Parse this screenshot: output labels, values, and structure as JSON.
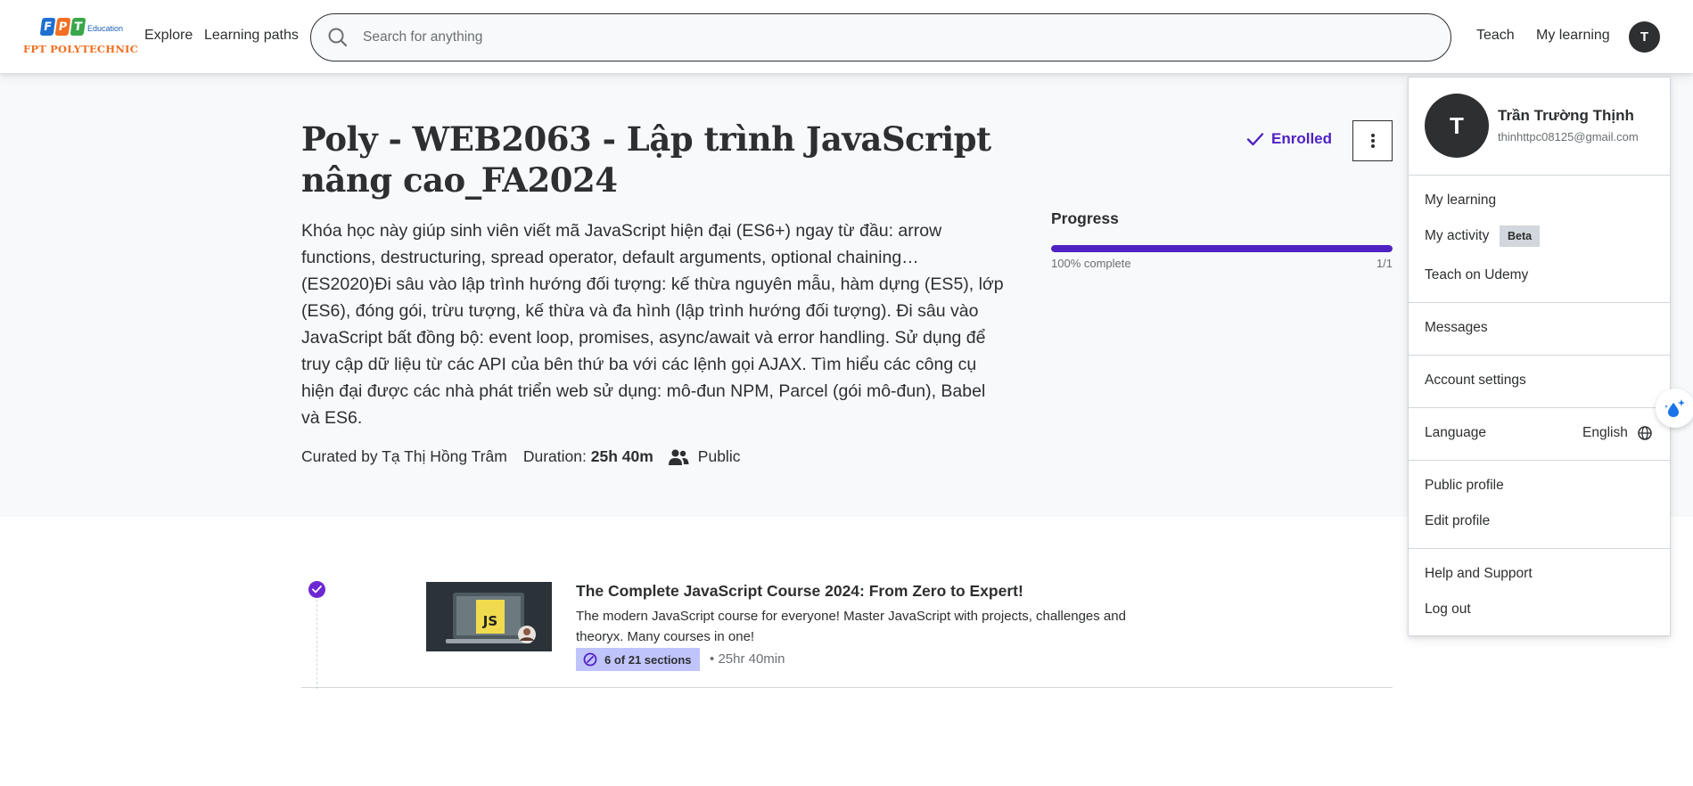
{
  "header": {
    "logo": {
      "letters": [
        "F",
        "P",
        "T"
      ],
      "colors": [
        "#1f6fd1",
        "#f26f21",
        "#3aa64a"
      ],
      "education": "Education",
      "wordmark": "FPT POLYTECHNIC"
    },
    "nav": {
      "explore": "Explore",
      "learning_paths": "Learning paths"
    },
    "search": {
      "placeholder": "Search for anything",
      "icon": "search-icon"
    },
    "right": {
      "teach": "Teach",
      "my_learning": "My learning",
      "avatar_initial": "T"
    }
  },
  "course_path": {
    "title": "Poly - WEB2063 - Lập trình JavaScript nâng cao_FA2024",
    "description": "Khóa học này giúp sinh viên viết mã JavaScript hiện đại (ES6+) ngay từ đầu: arrow functions, destructuring, spread operator, default arguments, optional chaining…(ES2020)Đi sâu vào lập trình hướng đối tượng: kế thừa nguyên mẫu, hàm dựng (ES5), lớp (ES6), đóng gói, trừu tượng, kế thừa và đa hình (lập trình hướng đối tượng). Đi sâu vào JavaScript bất đồng bộ: event loop, promises, async/await và error handling. Sử dụng để truy cập dữ liệu từ các API của bên thứ ba với các lệnh gọi AJAX. Tìm hiểu các công cụ hiện đại được các nhà phát triển web sử dụng: mô-đun NPM, Parcel (gói mô-đun), Babel và ES6.",
    "curated_by": "Curated by Tạ Thị Hồng Trâm",
    "duration_label": "Duration:",
    "duration_value": "25h 40m",
    "visibility": "Public",
    "enrolled": "Enrolled",
    "progress": {
      "title": "Progress",
      "label": "100% complete",
      "count": "1/1",
      "fraction": 1.0,
      "color": "#5022c3"
    }
  },
  "courses": [
    {
      "title": "The Complete JavaScript Course 2024: From Zero to Expert!",
      "description": "The modern JavaScript course for everyone! Master JavaScript with projects, challenges and theoryx. Many courses in one!",
      "thumbnail_text": "JS",
      "sections": "6 of 21 sections",
      "duration": "25hr 40min",
      "bullet": "•"
    }
  ],
  "dropdown": {
    "avatar_initial": "T",
    "name": "Trần Trường Thịnh",
    "email": "thinhttpc08125@gmail.com",
    "items": {
      "my_learning": "My learning",
      "my_activity": "My activity",
      "beta": "Beta",
      "teach": "Teach on Udemy",
      "messages": "Messages",
      "account_settings": "Account settings",
      "language": "Language",
      "language_value": "English",
      "public_profile": "Public profile",
      "edit_profile": "Edit profile",
      "help": "Help and Support",
      "logout": "Log out"
    }
  },
  "colors": {
    "accent": "#5022c3",
    "dark": "#2d2f31",
    "muted": "#6a6f73",
    "hero_bg": "#f7f9fa",
    "badge_bg": "#c0c4fc"
  }
}
